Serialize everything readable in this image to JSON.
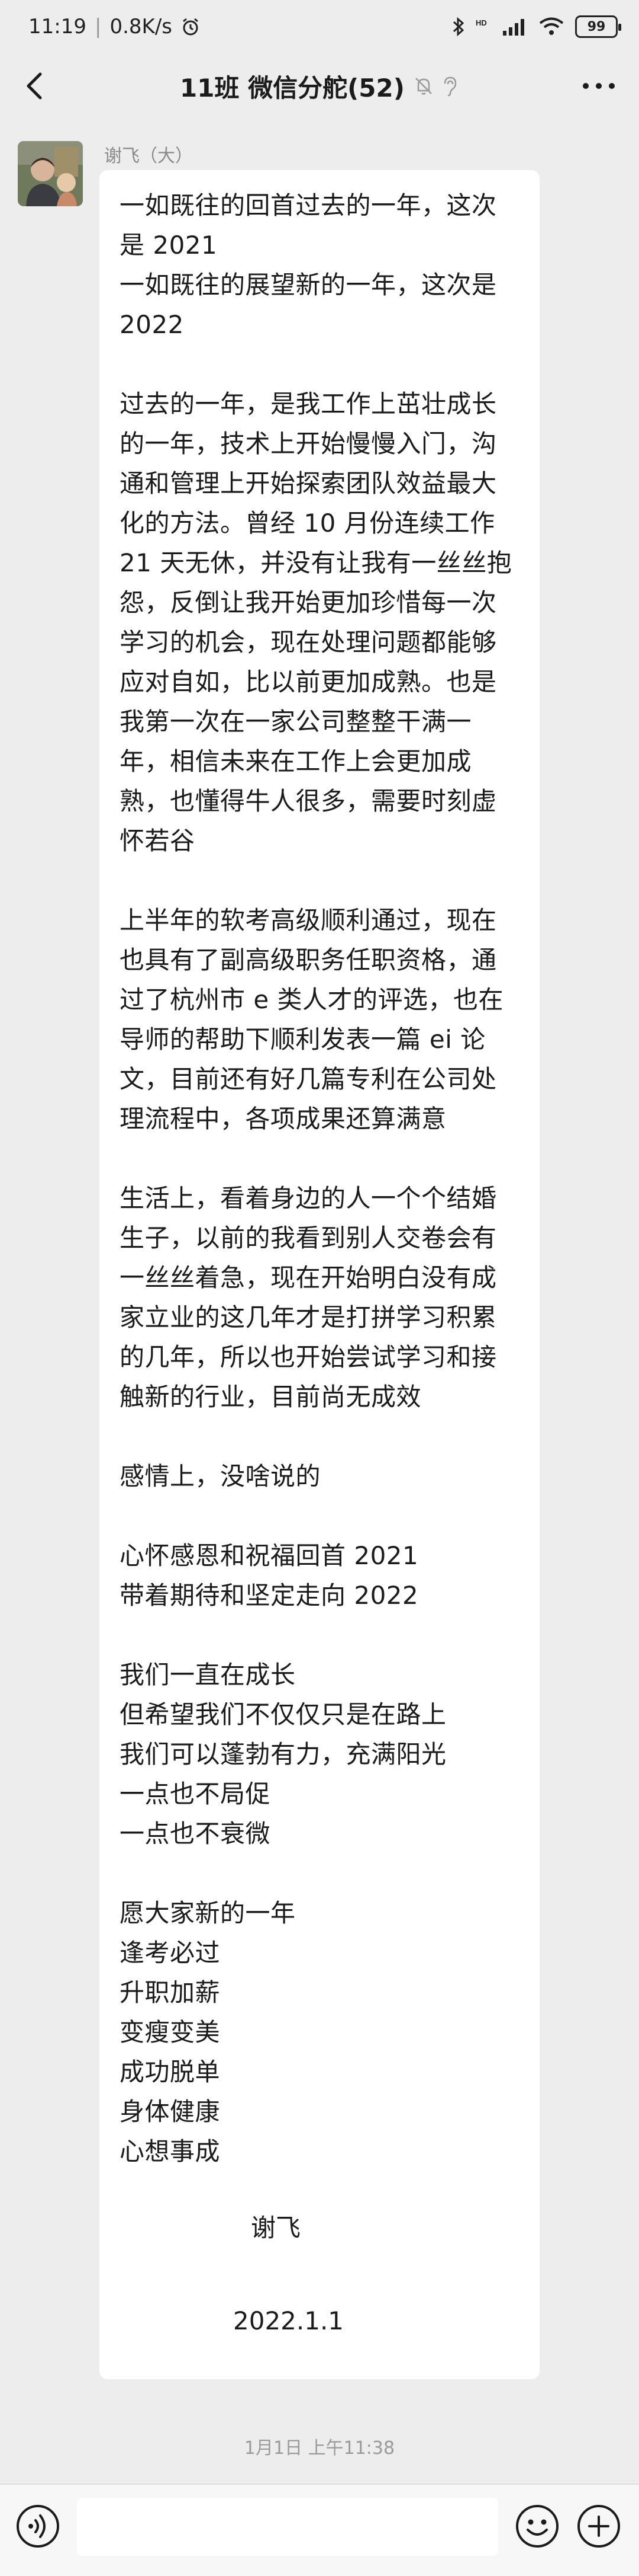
{
  "status_bar": {
    "time": "11:19",
    "network_speed": "0.8K/s",
    "battery": "99",
    "icons": [
      "alarm-icon",
      "bluetooth-icon",
      "hd-icon",
      "signal-icon",
      "wifi-icon",
      "battery-icon"
    ]
  },
  "nav": {
    "title": "11班 微信分舵(52)",
    "icons": [
      "back-arrow-icon",
      "mute-bell-icon",
      "ear-icon",
      "more-icon"
    ]
  },
  "message": {
    "sender": "谢飞（大）",
    "body": "一如既往的回首过去的一年，这次是 2021\n一如既往的展望新的一年，这次是 2022\n\n过去的一年，是我工作上茁壮成长的一年，技术上开始慢慢入门，沟通和管理上开始探索团队效益最大化的方法。曾经 10 月份连续工作 21 天无休，并没有让我有一丝丝抱怨，反倒让我开始更加珍惜每一次学习的机会，现在处理问题都能够应对自如，比以前更加成熟。也是我第一次在一家公司整整干满一年，相信未来在工作上会更加成熟，也懂得牛人很多，需要时刻虚怀若谷\n\n上半年的软考高级顺利通过，现在也具有了副高级职务任职资格，通过了杭州市 e 类人才的评选，也在导师的帮助下顺利发表一篇 ei 论文，目前还有好几篇专利在公司处理流程中，各项成果还算满意\n\n生活上，看着身边的人一个个结婚生子，以前的我看到别人交卷会有一丝丝着急，现在开始明白没有成家立业的这几年才是打拼学习积累的几年，所以也开始尝试学习和接触新的行业，目前尚无成效\n\n感情上，没啥说的\n\n心怀感恩和祝福回首 2021\n带着期待和坚定走向 2022\n\n我们一直在成长\n但希望我们不仅仅只是在路上\n我们可以蓬勃有力，充满阳光\n一点也不局促\n一点也不衰微\n\n愿大家新的一年\n逢考必过\n升职加薪\n变瘦变美\n成功脱单\n身体健康\n心想事成",
    "signature_name": "谢飞",
    "signature_date": "2022.1.1"
  },
  "timestamp": "1月1日 上午11:38",
  "input_bar": {
    "icons": [
      "voice-icon",
      "emoji-icon",
      "plus-icon"
    ]
  }
}
